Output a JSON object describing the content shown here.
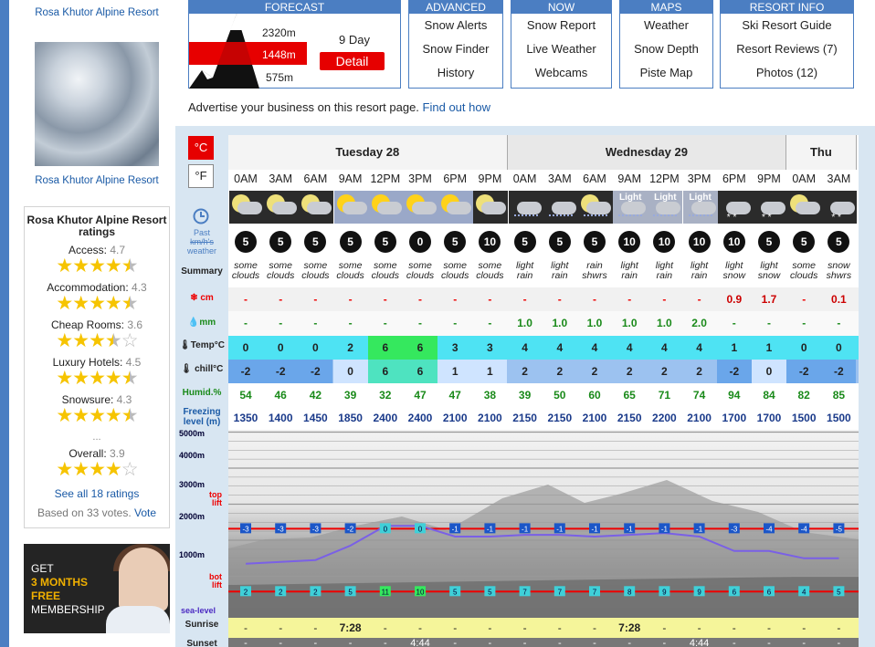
{
  "left": {
    "resort_link_top": "Rosa Khutor Alpine Resort",
    "resort_link_bottom": "Rosa Khutor Alpine Resort",
    "ratings_title": "Rosa Khutor Alpine Resort ratings",
    "ratings": [
      {
        "label": "Access:",
        "value": "4.7",
        "stars": 4.7
      },
      {
        "label": "Accommodation:",
        "value": "4.3",
        "stars": 4.3
      },
      {
        "label": "Cheap Rooms:",
        "value": "3.6",
        "stars": 3.6
      },
      {
        "label": "Luxury Hotels:",
        "value": "4.5",
        "stars": 4.5
      },
      {
        "label": "Snowsure:",
        "value": "4.3",
        "stars": 4.3
      }
    ],
    "ellipsis": "...",
    "overall_label": "Overall:",
    "overall_value": "3.9",
    "overall_stars": 3.9,
    "see_all": "See all 18 ratings",
    "based_on": "Based on 33 votes.",
    "vote_link": "Vote",
    "ad": {
      "line1": "GET",
      "line2": "3 MONTHS",
      "line3": "FREE",
      "line4": "MEMBERSHIP"
    }
  },
  "menus": {
    "forecast": {
      "header": "FORECAST",
      "elev_top": "2320m",
      "elev_mid": "1448m",
      "elev_bot": "575m",
      "nine_day": "9 Day",
      "detail": "Detail"
    },
    "advanced": {
      "header": "ADVANCED",
      "items": [
        "Snow Alerts",
        "Snow Finder",
        "History"
      ]
    },
    "now": {
      "header": "NOW",
      "items": [
        "Snow Report",
        "Live Weather",
        "Webcams"
      ]
    },
    "maps": {
      "header": "MAPS",
      "items": [
        "Weather",
        "Snow Depth",
        "Piste Map"
      ]
    },
    "resort_info": {
      "header": "RESORT INFO",
      "items": [
        "Ski Resort Guide",
        "Resort Reviews (7)",
        "Photos (12)"
      ]
    }
  },
  "advertise": {
    "text": "Advertise your business on this resort page.",
    "link": "Find out how"
  },
  "units": {
    "celsius": "°C",
    "fahrenheit": "°F"
  },
  "labels": {
    "wind_line1": "Past",
    "wind_line2": "km/h's",
    "wind_line3": "weather",
    "summary": "Summary",
    "snow": "cm",
    "rain": "mm",
    "temp": "Temp°C",
    "chill": "chill°C",
    "humid": "Humid.%",
    "freezing": "Freezing level (m)",
    "alt_5000": "5000m",
    "alt_4000": "4000m",
    "alt_3000": "3000m",
    "alt_2000": "2000m",
    "alt_1000": "1000m",
    "top_lift": "top lift",
    "bot_lift": "bot lift",
    "sea_level": "sea-level",
    "sunrise": "Sunrise",
    "sunset": "Sunset"
  },
  "days": [
    {
      "name": "Tuesday 28",
      "cols": 8
    },
    {
      "name": "Wednesday 29",
      "cols": 8
    },
    {
      "name": "Thu",
      "cols": 2
    }
  ],
  "times": [
    "0AM",
    "3AM",
    "6AM",
    "9AM",
    "12PM",
    "3PM",
    "6PM",
    "9PM",
    "0AM",
    "3AM",
    "6AM",
    "9AM",
    "12PM",
    "3PM",
    "6PM",
    "9PM",
    "0AM",
    "3AM"
  ],
  "weather_icons": [
    "moon-cloud",
    "moon-cloud",
    "moon-cloud",
    "sun-cloud",
    "sun-cloud",
    "sun-cloud",
    "sun-cloud",
    "moon-cloud",
    "rain-cloud",
    "rain-cloud",
    "moon-rain",
    "light-rain",
    "light-rain",
    "light-rain",
    "snow-cloud",
    "snow-cloud",
    "moon-cloud",
    "snow-cloud"
  ],
  "light_labels": [
    "",
    "",
    "",
    "",
    "",
    "",
    "",
    "",
    "",
    "",
    "",
    "Light",
    "Light",
    "Light",
    "",
    "",
    "",
    ""
  ],
  "wind": [
    "5",
    "5",
    "5",
    "5",
    "5",
    "0",
    "5",
    "10",
    "5",
    "5",
    "5",
    "10",
    "10",
    "10",
    "10",
    "5",
    "5",
    "5"
  ],
  "summary": [
    "some clouds",
    "some clouds",
    "some clouds",
    "some clouds",
    "some clouds",
    "some clouds",
    "some clouds",
    "some clouds",
    "light rain",
    "light rain",
    "rain shwrs",
    "light rain",
    "light rain",
    "light rain",
    "light snow",
    "light snow",
    "some clouds",
    "snow shwrs"
  ],
  "snow": [
    "-",
    "-",
    "-",
    "-",
    "-",
    "-",
    "-",
    "-",
    "-",
    "-",
    "-",
    "-",
    "-",
    "-",
    "0.9",
    "1.7",
    "-",
    "0.1"
  ],
  "rain": [
    "-",
    "-",
    "-",
    "-",
    "-",
    "-",
    "-",
    "-",
    "1.0",
    "1.0",
    "1.0",
    "1.0",
    "1.0",
    "2.0",
    "-",
    "-",
    "-",
    "-"
  ],
  "temp": [
    "0",
    "0",
    "0",
    "2",
    "6",
    "6",
    "3",
    "3",
    "4",
    "4",
    "4",
    "4",
    "4",
    "4",
    "1",
    "1",
    "0",
    "0"
  ],
  "chill": [
    "-2",
    "-2",
    "-2",
    "0",
    "6",
    "6",
    "1",
    "1",
    "2",
    "2",
    "2",
    "2",
    "2",
    "2",
    "-2",
    "0",
    "-2",
    "-2"
  ],
  "humid": [
    "54",
    "46",
    "42",
    "39",
    "32",
    "47",
    "47",
    "38",
    "39",
    "50",
    "60",
    "65",
    "71",
    "74",
    "94",
    "84",
    "82",
    "85"
  ],
  "freezing": [
    "1350",
    "1400",
    "1450",
    "1850",
    "2400",
    "2400",
    "2100",
    "2100",
    "2150",
    "2150",
    "2100",
    "2150",
    "2200",
    "2100",
    "1700",
    "1700",
    "1500",
    "1500"
  ],
  "top_lift_temps": [
    "-3",
    "-3",
    "-3",
    "-2",
    "0",
    "0",
    "-1",
    "-1",
    "-1",
    "-1",
    "-1",
    "-1",
    "-1",
    "-1",
    "-3",
    "-4",
    "-4",
    "-5"
  ],
  "bot_lift_temps": [
    "2",
    "2",
    "2",
    "5",
    "11",
    "10",
    "5",
    "5",
    "7",
    "7",
    "7",
    "8",
    "9",
    "9",
    "6",
    "6",
    "4",
    "5"
  ],
  "sunrise": [
    "-",
    "-",
    "-",
    "7:28",
    "-",
    "-",
    "-",
    "-",
    "-",
    "-",
    "-",
    "7:28",
    "-",
    "-",
    "-",
    "-",
    "-",
    "-"
  ],
  "sunset": [
    "-",
    "-",
    "-",
    "-",
    "-",
    "4:44",
    "-",
    "-",
    "-",
    "-",
    "-",
    "-",
    "-",
    "4:44",
    "-",
    "-",
    "-",
    "-"
  ],
  "colors": {
    "brand": "#4b7ec2",
    "accent": "#e60000",
    "temp_cold": "#4ee3f3",
    "temp_warm": "#35e85e",
    "freezing_line": "#7a60e6"
  }
}
